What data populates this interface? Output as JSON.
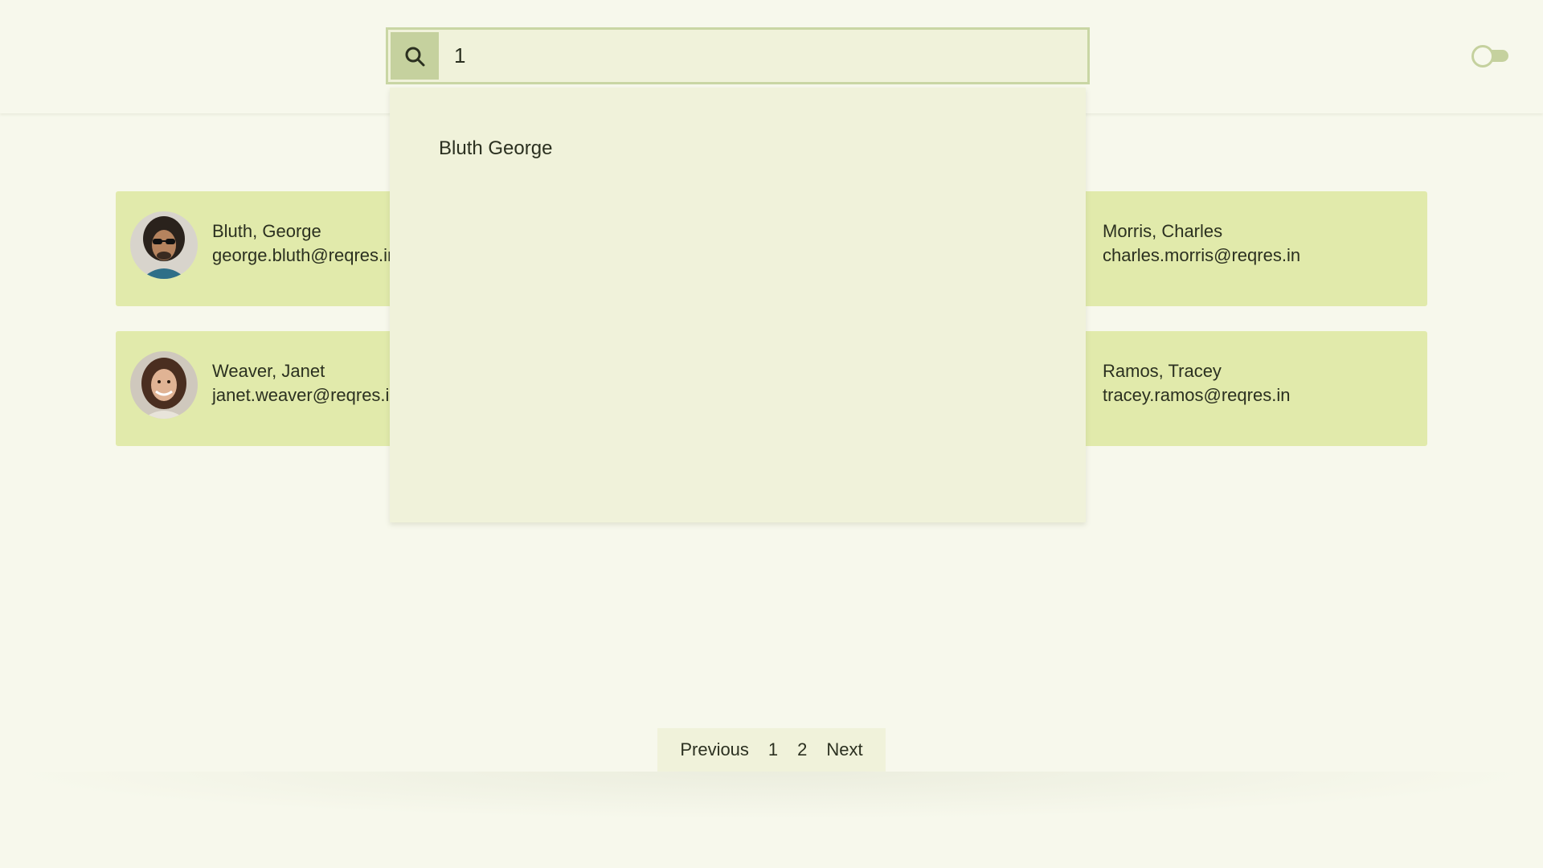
{
  "search": {
    "value": "1",
    "suggestions": [
      "Bluth George"
    ]
  },
  "users": [
    {
      "name": "Bluth, George",
      "email": "george.bluth@reqres.in"
    },
    {
      "name": "Morris, Charles",
      "email": "charles.morris@reqres.in"
    },
    {
      "name": "Weaver, Janet",
      "email": "janet.weaver@reqres.in"
    },
    {
      "name": "Ramos, Tracey",
      "email": "tracey.ramos@reqres.in"
    }
  ],
  "pagination": {
    "previous": "Previous",
    "page1": "1",
    "page2": "2",
    "next": "Next"
  },
  "colors": {
    "background": "#f7f8ec",
    "card": "#e1eaab",
    "accent": "#c5d19e",
    "dropdown": "#f0f2da"
  },
  "icons": {
    "search": "search-icon",
    "theme_toggle": "toggle-icon"
  }
}
